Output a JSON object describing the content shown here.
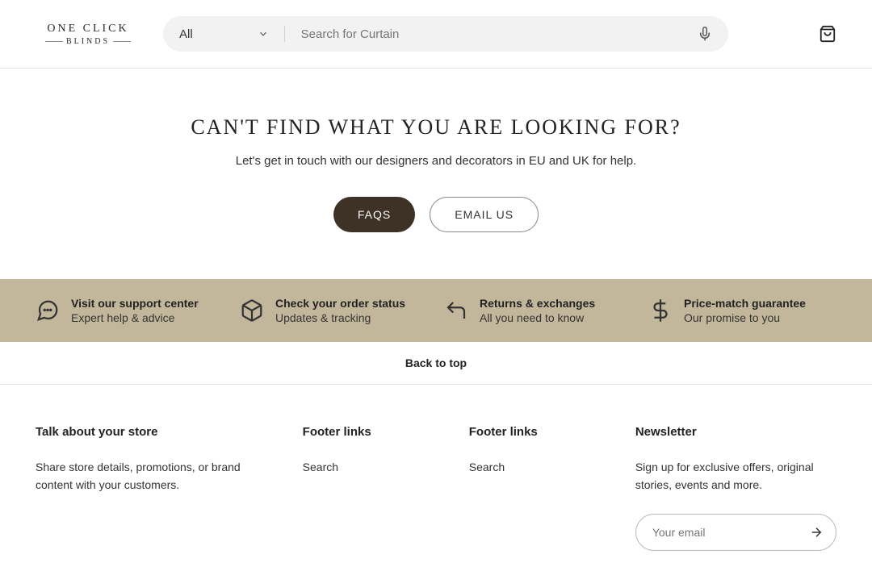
{
  "header": {
    "logo_line1": "ONE CLICK",
    "logo_line2": "BLINDS",
    "search_select": "All",
    "search_placeholder": "Search for Curtain"
  },
  "hero": {
    "title": "CAN'T FIND WHAT YOU ARE LOOKING FOR?",
    "subtitle": "Let's get in touch with our designers and decorators in EU and UK for help.",
    "faqs_label": "FAQS",
    "email_label": "EMAIL US"
  },
  "features": [
    {
      "title": "Visit our support center",
      "sub": "Expert help & advice"
    },
    {
      "title": "Check your order status",
      "sub": "Updates & tracking"
    },
    {
      "title": "Returns & exchanges",
      "sub": "All you need to know"
    },
    {
      "title": "Price-match guarantee",
      "sub": "Our promise to you"
    }
  ],
  "back_to_top": "Back to top",
  "footer": {
    "col1": {
      "heading": "Talk about your store",
      "body": "Share store details, promotions, or brand content with your customers."
    },
    "col2": {
      "heading": "Footer links",
      "links": [
        "Search"
      ]
    },
    "col3": {
      "heading": "Footer links",
      "links": [
        "Search"
      ]
    },
    "col4": {
      "heading": "Newsletter",
      "body": "Sign up for exclusive offers, original stories, events and more.",
      "email_placeholder": "Your email"
    }
  }
}
